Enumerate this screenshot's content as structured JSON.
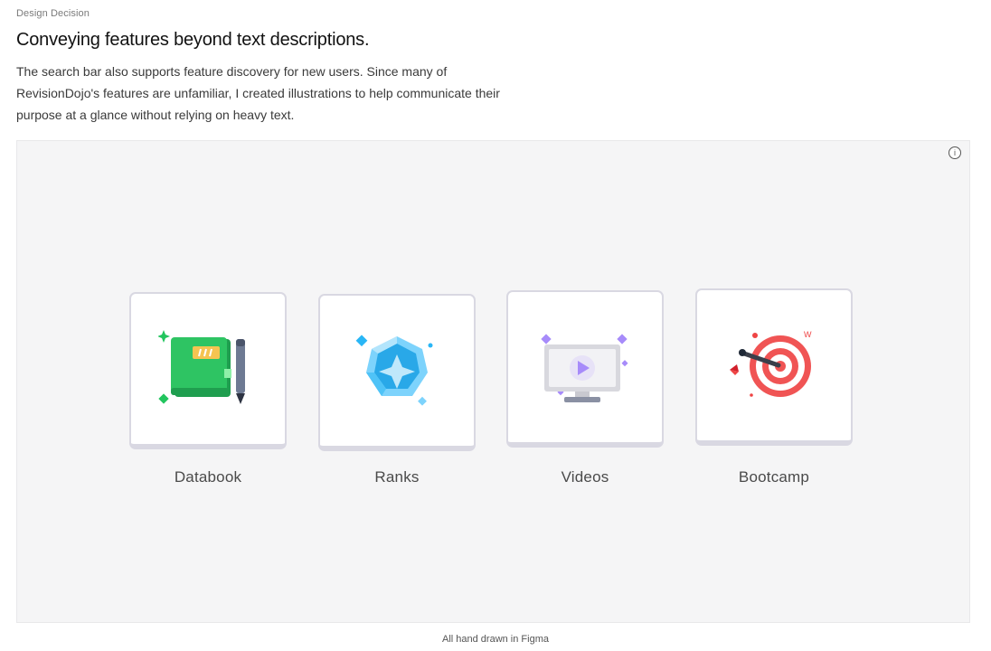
{
  "header": {
    "eyebrow": "Design Decision",
    "title": "Conveying features beyond text descriptions.",
    "description": "The search bar also supports feature discovery for new users. Since many of RevisionDojo's features are unfamiliar, I created illustrations to help communicate their purpose at a glance without relying on heavy text."
  },
  "showcase": {
    "info_icon": "info-icon",
    "info_symbol": "i",
    "cards": [
      {
        "label": "Databook",
        "icon": "databook-icon",
        "accent": "#22c55e"
      },
      {
        "label": "Ranks",
        "icon": "ranks-gem-icon",
        "accent": "#29b6f6"
      },
      {
        "label": "Videos",
        "icon": "videos-monitor-icon",
        "accent": "#a78bfa"
      },
      {
        "label": "Bootcamp",
        "icon": "bootcamp-target-icon",
        "accent": "#f05454"
      }
    ]
  },
  "caption": "All hand drawn in Figma"
}
